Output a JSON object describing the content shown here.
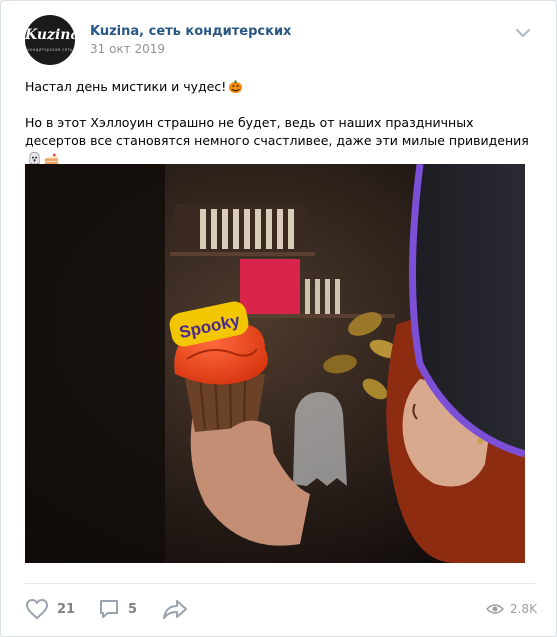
{
  "post": {
    "author": "Kuzina, сеть кондитерских",
    "date": "31 окт 2019",
    "avatar_logo": "Kuzina",
    "avatar_subtitle": "кондитерская сеть",
    "text_line1": "Настал день мистики и чудес!",
    "text_line2": "Но в этот Хэллоуин страшно не будет, ведь от наших праздничных десертов все становятся немного счастливее, даже эти милые привидения",
    "photo_topper": "Spooky"
  },
  "actions": {
    "likes": "21",
    "comments": "5",
    "views": "2.8K"
  },
  "icons": {
    "menu": "chevron-down-icon",
    "like": "heart-icon",
    "comment": "comment-icon",
    "share": "share-icon",
    "views": "eye-icon",
    "emoji1": "jack-o-lantern-icon",
    "emoji2": "ghost-icon",
    "emoji3": "cake-slice-icon"
  },
  "colors": {
    "link": "#2a5885",
    "muted": "#828282",
    "topper": "#f2c600",
    "frosting": "#f04a1e",
    "hat_brim": "#7b4fd6"
  }
}
